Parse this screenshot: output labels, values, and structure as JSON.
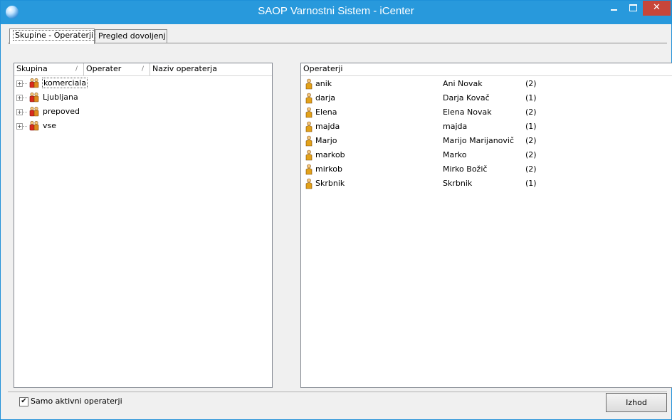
{
  "window": {
    "title": "SAOP Varnostni Sistem - iCenter",
    "minimize_glyph": "",
    "maximize_glyph": "",
    "close_glyph": "✕"
  },
  "tabs": [
    {
      "label": "Skupine - Operaterji",
      "active": true
    },
    {
      "label": "Pregled dovoljenj",
      "active": false
    }
  ],
  "groups_panel": {
    "columns": [
      "Skupina",
      "Operater",
      "Naziv operaterja"
    ],
    "sort_glyph": "/",
    "expand_glyph": "+",
    "items": [
      {
        "label": "komerciala",
        "selected": true
      },
      {
        "label": "Ljubljana",
        "selected": false
      },
      {
        "label": "prepoved",
        "selected": false
      },
      {
        "label": "vse",
        "selected": false
      }
    ]
  },
  "operators_panel": {
    "header": "Operaterji",
    "rows": [
      {
        "login": "anik",
        "name": "Ani Novak",
        "count": "(2)"
      },
      {
        "login": "darja",
        "name": "Darja Kovač",
        "count": "(1)"
      },
      {
        "login": "Elena",
        "name": "Elena Novak",
        "count": "(2)"
      },
      {
        "login": "majda",
        "name": "majda",
        "count": "(1)"
      },
      {
        "login": "Marjo",
        "name": "Marijo Marijanovič",
        "count": "(2)"
      },
      {
        "login": "markob",
        "name": "Marko",
        "count": "(2)"
      },
      {
        "login": "mirkob",
        "name": "Mirko Božič",
        "count": "(2)"
      },
      {
        "login": "Skrbnik",
        "name": "Skrbnik",
        "count": "(1)"
      }
    ]
  },
  "footer": {
    "checkbox_label": "Samo aktivni operaterji",
    "checkbox_checked": true,
    "check_glyph": "✔",
    "exit_button": "Izhod"
  },
  "colors": {
    "titlebar": "#2899dc",
    "close_button": "#c7463a",
    "panel_border": "#828790"
  }
}
